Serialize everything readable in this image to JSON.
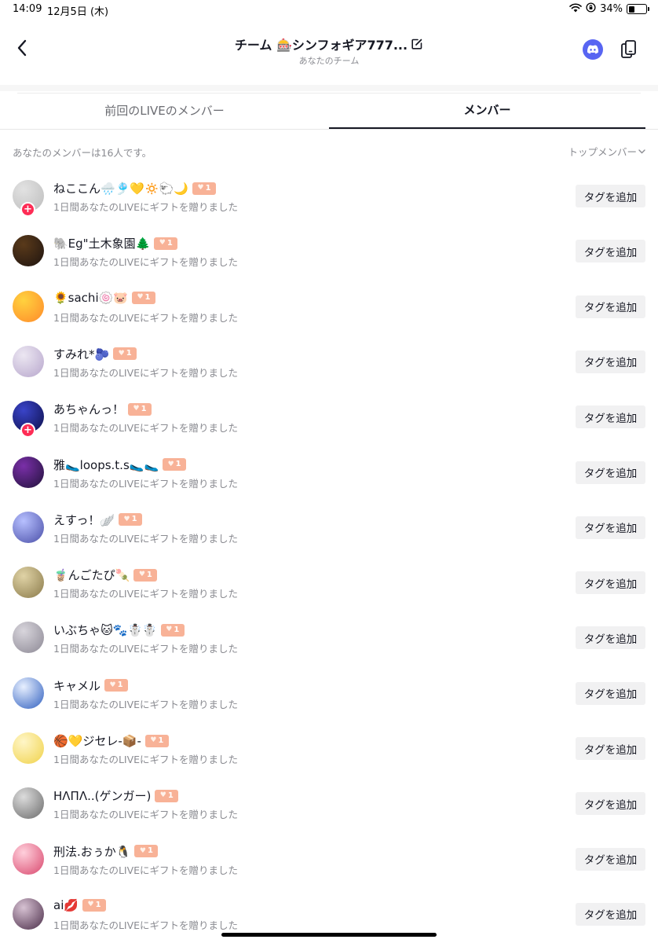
{
  "status_bar": {
    "time": "14:09",
    "date": "12月5日 (木)",
    "battery": "34%",
    "battery_level": 0.34
  },
  "header": {
    "title": "チーム 🎰シンフォギア777...",
    "subtitle": "あなたのチーム",
    "icons": {
      "back": "chevron-left-icon",
      "edit": "edit-icon",
      "discord": "discord-icon",
      "copy": "copy-icon"
    }
  },
  "tabs": [
    {
      "label": "前回のLIVEのメンバー",
      "active": false
    },
    {
      "label": "メンバー",
      "active": true
    }
  ],
  "summary": {
    "count_text": "あなたのメンバーは16人です。",
    "sort_label": "トップメンバー"
  },
  "colors": {
    "accent": "#fe2c55",
    "badge": "#f8b297",
    "discord": "#5865F2",
    "text_primary": "#161823",
    "text_secondary": "#8a8b91"
  },
  "members": [
    {
      "name": "ねここん🌧️🎐💛🔅🐑🌙",
      "level": "1",
      "gift_text": "1日間あなたのLIVEにギフトを贈りました",
      "tag_label": "タグを追加",
      "follow_badge": true,
      "avatar": [
        "#e2e2e2",
        "#bdbdbd"
      ]
    },
    {
      "name": "🐘Eg\"土木象園🌲",
      "level": "1",
      "gift_text": "1日間あなたのLIVEにギフトを贈りました",
      "tag_label": "タグを追加",
      "follow_badge": false,
      "avatar": [
        "#5a3a1a",
        "#1e1410"
      ]
    },
    {
      "name": "🌻sachi🍥🐷",
      "level": "1",
      "gift_text": "1日間あなたのLIVEにギフトを贈りました",
      "tag_label": "タグを追加",
      "follow_badge": false,
      "avatar": [
        "#ffd23f",
        "#ff8a2a"
      ]
    },
    {
      "name": "すみれ*🫐",
      "level": "1",
      "gift_text": "1日間あなたのLIVEにギフトを贈りました",
      "tag_label": "タグを追加",
      "follow_badge": false,
      "avatar": [
        "#ece7f2",
        "#b7a6cc"
      ]
    },
    {
      "name": "あちゃんっ！",
      "level": "1",
      "gift_text": "1日間あなたのLIVEにギフトを贈りました",
      "tag_label": "タグを追加",
      "follow_badge": true,
      "avatar": [
        "#3a44c9",
        "#0c0f4a"
      ]
    },
    {
      "name": "雅🥿loops.t.s🥿🥿",
      "level": "1",
      "gift_text": "1日間あなたのLIVEにギフトを贈りました",
      "tag_label": "タグを追加",
      "follow_badge": false,
      "avatar": [
        "#7a2fa8",
        "#20123a"
      ]
    },
    {
      "name": "えすっ！🪽",
      "level": "1",
      "gift_text": "1日間あなたのLIVEにギフトを贈りました",
      "tag_label": "タグを追加",
      "follow_badge": false,
      "avatar": [
        "#b7c0ff",
        "#4a4fa8"
      ]
    },
    {
      "name": "🧋んごたぴ🍡",
      "level": "1",
      "gift_text": "1日間あなたのLIVEにギフトを贈りました",
      "tag_label": "タグを追加",
      "follow_badge": false,
      "avatar": [
        "#e0d3a6",
        "#8a7a4a"
      ]
    },
    {
      "name": "いぶちゃ🐱🐾☃️☃️",
      "level": "1",
      "gift_text": "1日間あなたのLIVEにギフトを贈りました",
      "tag_label": "タグを追加",
      "follow_badge": false,
      "avatar": [
        "#d8d5dc",
        "#8c8894"
      ]
    },
    {
      "name": "キャメル",
      "level": "1",
      "gift_text": "1日間あなたのLIVEにギフトを贈りました",
      "tag_label": "タグを追加",
      "follow_badge": false,
      "avatar": [
        "#e8f0ff",
        "#2f5fbf"
      ]
    },
    {
      "name": "🏀💛ジセレ-📦-",
      "level": "1",
      "gift_text": "1日間あなたのLIVEにギフトを贈りました",
      "tag_label": "タグを追加",
      "follow_badge": false,
      "avatar": [
        "#fff6c8",
        "#f0d24a"
      ]
    },
    {
      "name": "HΛΠΛ..(ゲンガー)",
      "level": "1",
      "gift_text": "1日間あなたのLIVEにギフトを贈りました",
      "tag_label": "タグを追加",
      "follow_badge": false,
      "avatar": [
        "#dcdcdc",
        "#6b6b6b"
      ]
    },
    {
      "name": "刑法.おぅか🐧",
      "level": "1",
      "gift_text": "1日間あなたのLIVEにギフトを贈りました",
      "tag_label": "タグを追加",
      "follow_badge": false,
      "avatar": [
        "#ffd0dc",
        "#d9476d"
      ]
    },
    {
      "name": "ai💋",
      "level": "1",
      "gift_text": "1日間あなたのLIVEにギフトを贈りました",
      "tag_label": "タグを追加",
      "follow_badge": false,
      "avatar": [
        "#d7c2d3",
        "#4a2c48"
      ]
    }
  ]
}
